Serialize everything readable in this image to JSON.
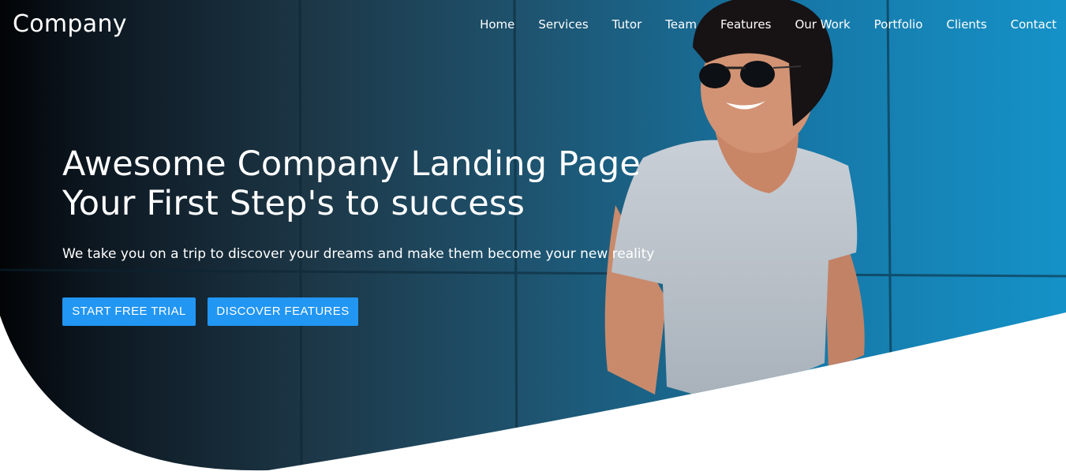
{
  "brand": {
    "name": "Company"
  },
  "nav": {
    "items": [
      {
        "label": "Home"
      },
      {
        "label": "Services"
      },
      {
        "label": "Tutor"
      },
      {
        "label": "Team"
      },
      {
        "label": "Features"
      },
      {
        "label": "Our Work"
      },
      {
        "label": "Portfolio"
      },
      {
        "label": "Clients"
      },
      {
        "label": "Contact"
      }
    ]
  },
  "hero": {
    "headline_line1": "Awesome Company Landing Page",
    "headline_line2": "Your First Step's to success",
    "subtitle": "We take you on a trip to discover your dreams and make them become your new reality",
    "primary_button": "START FREE TRIAL",
    "secondary_button": "DISCOVER FEATURES"
  },
  "colors": {
    "accent": "#2196f3",
    "overlay_dark": "#05090d",
    "wall_blue": "#1a8ac0"
  },
  "icons": [
    "hero-photo-man-in-hat"
  ]
}
